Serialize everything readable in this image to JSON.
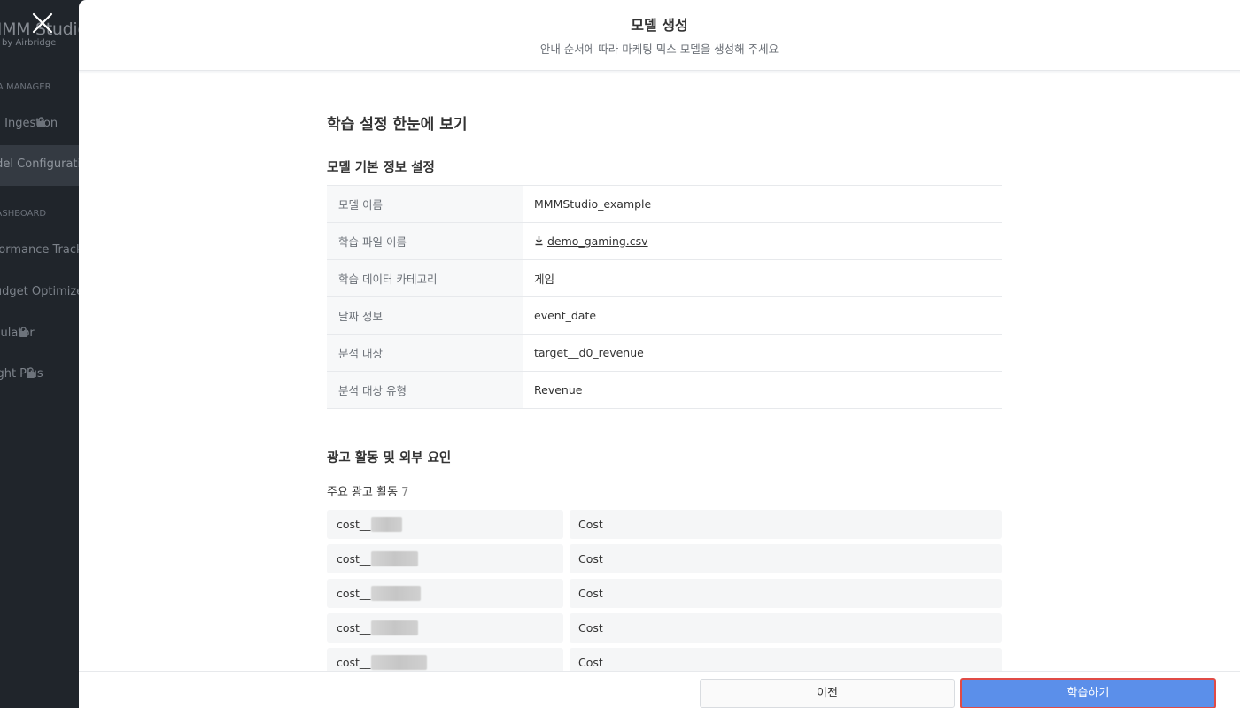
{
  "sidebar": {
    "logo": "MMM Studio",
    "logo_sub": "by Airbridge",
    "sections": [
      "DATA MANAGER",
      "DASHBOARD"
    ],
    "items": [
      {
        "label": "Data Ingestion",
        "locked": true
      },
      {
        "label": "Model Configuration",
        "locked": false,
        "active": true
      },
      {
        "label": "Performance Tracker",
        "locked": false
      },
      {
        "label": "Budget Optimizer",
        "locked": false
      },
      {
        "label": "Simulator",
        "locked": true
      },
      {
        "label": "Insight Plus",
        "locked": true
      }
    ]
  },
  "modal": {
    "title": "모델 생성",
    "subtitle": "안내 순서에 따라 마케팅 믹스 모델을 생성해 주세요",
    "overview_heading": "학습 설정 한눈에 보기",
    "basic_section": {
      "heading": "모델 기본 정보 설정",
      "rows": [
        {
          "key": "모델 이름",
          "value": "MMMStudio_example"
        },
        {
          "key": "학습 파일 이름",
          "value": "demo_gaming.csv",
          "is_file": true
        },
        {
          "key": "학습 데이터 카테고리",
          "value": "게임"
        },
        {
          "key": "날짜 정보",
          "value": "event_date"
        },
        {
          "key": "분석 대상",
          "value": "target__d0_revenue"
        },
        {
          "key": "분석 대상 유형",
          "value": "Revenue"
        }
      ]
    },
    "ad_section": {
      "heading": "광고 활동 및 외부 요인",
      "sub_label": "주요 광고 활동",
      "sub_count": "7",
      "items": [
        {
          "name": "cost__",
          "type": "Cost"
        },
        {
          "name": "cost__",
          "type": "Cost"
        },
        {
          "name": "cost__",
          "type": "Cost"
        },
        {
          "name": "cost__",
          "type": "Cost"
        },
        {
          "name": "cost__",
          "type": "Cost"
        }
      ]
    }
  },
  "footer": {
    "prev_label": "이전",
    "train_label": "학습하기"
  },
  "colors": {
    "primary": "#5b8fea",
    "highlight_border": "#e04b46",
    "sidebar_bg": "#20252b"
  }
}
